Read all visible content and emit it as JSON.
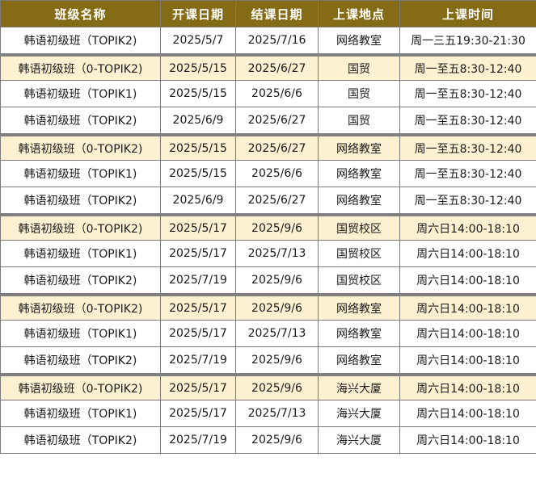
{
  "table": {
    "headers": [
      "班级名称",
      "开课日期",
      "结课日期",
      "上课地点",
      "上课时间"
    ],
    "rows": [
      {
        "name": "韩语初级班（TOPIK2)",
        "start": "2025/5/7",
        "end": "2025/7/16",
        "location": "网络教室",
        "time": "周一三五19:30-21:30"
      },
      {
        "name": "韩语初级班（0-TOPIK2)",
        "start": "2025/5/15",
        "end": "2025/6/27",
        "location": "国贸",
        "time": "周一至五8:30-12:40"
      },
      {
        "name": "韩语初级班（TOPIK1)",
        "start": "2025/5/15",
        "end": "2025/6/6",
        "location": "国贸",
        "time": "周一至五8:30-12:40"
      },
      {
        "name": "韩语初级班（TOPIK2)",
        "start": "2025/6/9",
        "end": "2025/6/27",
        "location": "国贸",
        "time": "周一至五8:30-12:40"
      },
      {
        "name": "韩语初级班（0-TOPIK2)",
        "start": "2025/5/15",
        "end": "2025/6/27",
        "location": "网络教室",
        "time": "周一至五8:30-12:40"
      },
      {
        "name": "韩语初级班（TOPIK1)",
        "start": "2025/5/15",
        "end": "2025/6/6",
        "location": "网络教室",
        "time": "周一至五8:30-12:40"
      },
      {
        "name": "韩语初级班（TOPIK2)",
        "start": "2025/6/9",
        "end": "2025/6/27",
        "location": "网络教室",
        "time": "周一至五8:30-12:40"
      },
      {
        "name": "韩语初级班（0-TOPIK2)",
        "start": "2025/5/17",
        "end": "2025/9/6",
        "location": "国贸校区",
        "time": "周六日14:00-18:10"
      },
      {
        "name": "韩语初级班（TOPIK1)",
        "start": "2025/5/17",
        "end": "2025/7/13",
        "location": "国贸校区",
        "time": "周六日14:00-18:10"
      },
      {
        "name": "韩语初级班（TOPIK2)",
        "start": "2025/7/19",
        "end": "2025/9/6",
        "location": "国贸校区",
        "time": "周六日14:00-18:10"
      },
      {
        "name": "韩语初级班（0-TOPIK2)",
        "start": "2025/5/17",
        "end": "2025/9/6",
        "location": "网络教室",
        "time": "周六日14:00-18:10"
      },
      {
        "name": "韩语初级班（TOPIK1)",
        "start": "2025/5/17",
        "end": "2025/7/13",
        "location": "网络教室",
        "time": "周六日14:00-18:10"
      },
      {
        "name": "韩语初级班（TOPIK2)",
        "start": "2025/7/19",
        "end": "2025/9/6",
        "location": "网络教室",
        "time": "周六日14:00-18:10"
      },
      {
        "name": "韩语初级班（0-TOPIK2)",
        "start": "2025/5/17",
        "end": "2025/9/6",
        "location": "海兴大厦",
        "time": "周六日14:00-18:10"
      },
      {
        "name": "韩语初级班（TOPIK1)",
        "start": "2025/5/17",
        "end": "2025/7/13",
        "location": "海兴大厦",
        "time": "周六日14:00-18:10"
      },
      {
        "name": "韩语初级班（TOPIK2)",
        "start": "2025/7/19",
        "end": "2025/9/6",
        "location": "海兴大厦",
        "time": "周六日14:00-18:10"
      }
    ]
  },
  "colors": {
    "header_bg": "#866b16",
    "header_text": "#ffffff",
    "highlight_row_bg": "#fdf1d2",
    "border": "#7a7a7a"
  }
}
